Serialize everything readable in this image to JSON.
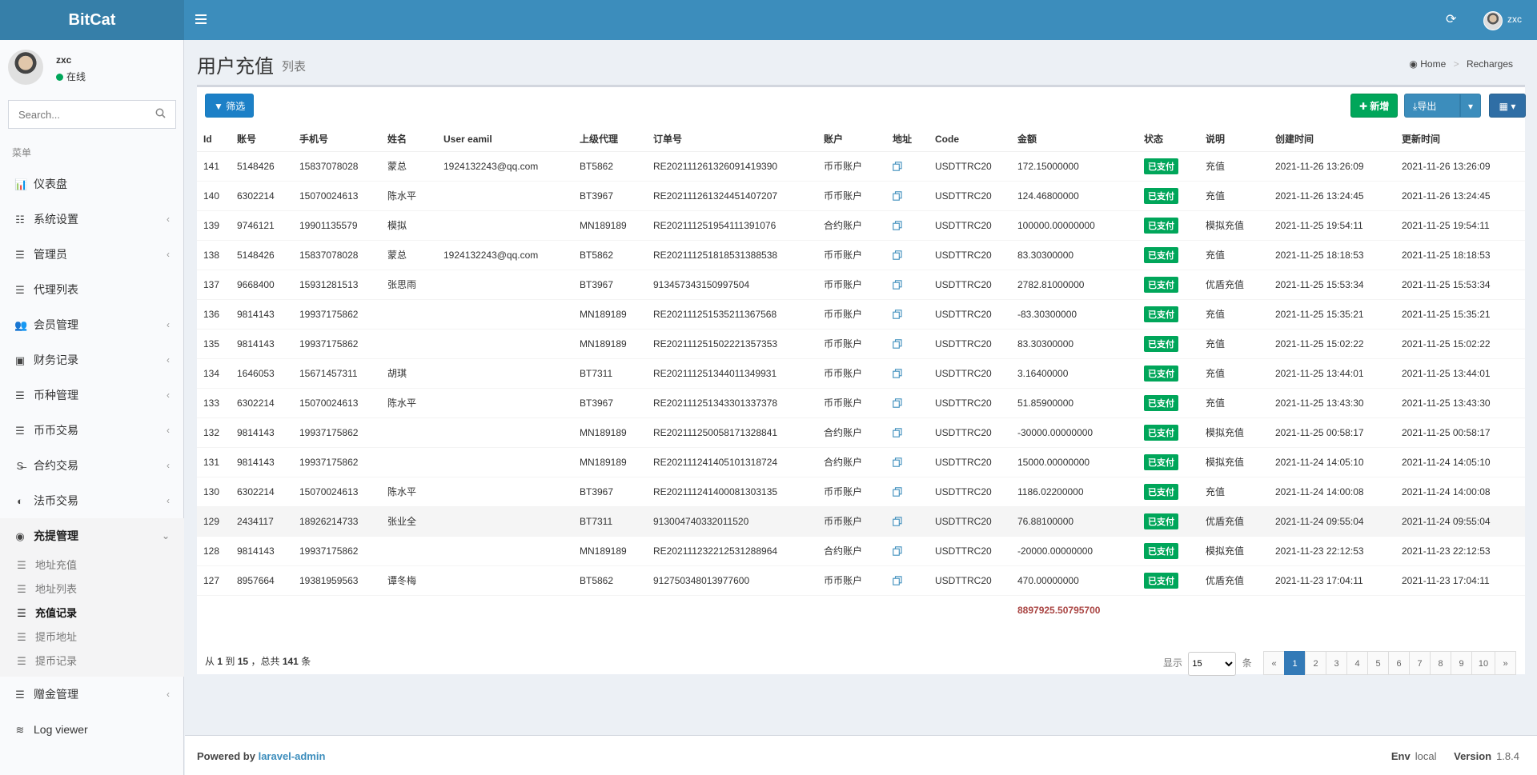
{
  "header": {
    "logo": "BitCat",
    "user": "zxc",
    "refresh_icon": "refresh-icon",
    "menu_icon": "hamburger-icon"
  },
  "sidebar": {
    "user_name": "zxc",
    "status": "在线",
    "search_placeholder": "Search...",
    "menu_header": "菜单",
    "items": [
      {
        "label": "仪表盘",
        "icon": "bar-chart-icon"
      },
      {
        "label": "系统设置",
        "icon": "sliders-icon"
      },
      {
        "label": "管理员",
        "icon": "server-icon"
      },
      {
        "label": "代理列表",
        "icon": "list-icon"
      },
      {
        "label": "会员管理",
        "icon": "users-icon"
      },
      {
        "label": "财务记录",
        "icon": "money-icon"
      },
      {
        "label": "币种管理",
        "icon": "list-icon"
      },
      {
        "label": "币币交易",
        "icon": "list-icon"
      },
      {
        "label": "合约交易",
        "icon": "strikethrough-icon"
      },
      {
        "label": "法币交易",
        "icon": "adjust-icon"
      },
      {
        "label": "充提管理",
        "icon": "dashboard-icon"
      },
      {
        "label": "赠金管理",
        "icon": "list-icon"
      },
      {
        "label": "Log viewer",
        "icon": "database-icon"
      }
    ],
    "sub_items": [
      {
        "label": "地址充值"
      },
      {
        "label": "地址列表"
      },
      {
        "label": "充值记录"
      },
      {
        "label": "提币地址"
      },
      {
        "label": "提币记录"
      }
    ]
  },
  "content": {
    "title": "用户充值",
    "subtitle": "列表",
    "breadcrumb": [
      "Home",
      "Recharges"
    ],
    "buttons": {
      "filter": "筛选",
      "add": "新增",
      "export": "导出"
    },
    "table": {
      "headers": [
        "Id",
        "账号",
        "手机号",
        "姓名",
        "User eamil",
        "上级代理",
        "订单号",
        "账户",
        "地址",
        "Code",
        "金额",
        "状态",
        "说明",
        "创建时间",
        "更新时间"
      ],
      "rows": [
        [
          "141",
          "5148426",
          "15837078028",
          "蒙总",
          "1924132243@qq.com",
          "BT5862",
          "RE20211126132609141939​0",
          "币币账户",
          "",
          "USDTTRC20",
          "172.15000000",
          "已支付",
          "充值",
          "2021-11-26 13:26:09",
          "2021-11-26 13:26:09"
        ],
        [
          "140",
          "6302214",
          "15070024613",
          "陈水平",
          "",
          "BT3967",
          "RE202111261324451407207",
          "币币账户",
          "",
          "USDTTRC20",
          "124.46800000",
          "已支付",
          "充值",
          "2021-11-26 13:24:45",
          "2021-11-26 13:24:45"
        ],
        [
          "139",
          "9746121",
          "19901135579",
          "模拟",
          "",
          "MN189189",
          "RE202111251954111391076",
          "合约账户",
          "",
          "USDTTRC20",
          "100000.00000000",
          "已支付",
          "模拟充值",
          "2021-11-25 19:54:11",
          "2021-11-25 19:54:11"
        ],
        [
          "138",
          "5148426",
          "15837078028",
          "蒙总",
          "1924132243@qq.com",
          "BT5862",
          "RE202111251818531388538",
          "币币账户",
          "",
          "USDTTRC20",
          "83.30300000",
          "已支付",
          "充值",
          "2021-11-25 18:18:53",
          "2021-11-25 18:18:53"
        ],
        [
          "137",
          "9668400",
          "15931281513",
          "张思雨",
          "",
          "BT3967",
          "913457343150997504",
          "币币账户",
          "",
          "USDTTRC20",
          "2782.81000000",
          "已支付",
          "优盾充值",
          "2021-11-25 15:53:34",
          "2021-11-25 15:53:34"
        ],
        [
          "136",
          "9814143",
          "19937175862",
          "",
          "",
          "MN189189",
          "RE202111251535211367568",
          "币币账户",
          "",
          "USDTTRC20",
          "-83.30300000",
          "已支付",
          "充值",
          "2021-11-25 15:35:21",
          "2021-11-25 15:35:21"
        ],
        [
          "135",
          "9814143",
          "19937175862",
          "",
          "",
          "MN189189",
          "RE202111251502221357353",
          "币币账户",
          "",
          "USDTTRC20",
          "83.30300000",
          "已支付",
          "充值",
          "2021-11-25 15:02:22",
          "2021-11-25 15:02:22"
        ],
        [
          "134",
          "1646053",
          "15671457311",
          "胡琪",
          "",
          "BT7311",
          "RE202111251344011349931",
          "币币账户",
          "",
          "USDTTRC20",
          "3.16400000",
          "已支付",
          "充值",
          "2021-11-25 13:44:01",
          "2021-11-25 13:44:01"
        ],
        [
          "133",
          "6302214",
          "15070024613",
          "陈水平",
          "",
          "BT3967",
          "RE202111251343301337378",
          "币币账户",
          "",
          "USDTTRC20",
          "51.85900000",
          "已支付",
          "充值",
          "2021-11-25 13:43:30",
          "2021-11-25 13:43:30"
        ],
        [
          "132",
          "9814143",
          "19937175862",
          "",
          "",
          "MN189189",
          "RE202111250058171328841",
          "合约账户",
          "",
          "USDTTRC20",
          "-30000.00000000",
          "已支付",
          "模拟充值",
          "2021-11-25 00:58:17",
          "2021-11-25 00:58:17"
        ],
        [
          "131",
          "9814143",
          "19937175862",
          "",
          "",
          "MN189189",
          "RE202111241405101318724",
          "合约账户",
          "",
          "USDTTRC20",
          "15000.00000000",
          "已支付",
          "模拟充值",
          "2021-11-24 14:05:10",
          "2021-11-24 14:05:10"
        ],
        [
          "130",
          "6302214",
          "15070024613",
          "陈水平",
          "",
          "BT3967",
          "RE202111241400081303135",
          "币币账户",
          "",
          "USDTTRC20",
          "1186.02200000",
          "已支付",
          "充值",
          "2021-11-24 14:00:08",
          "2021-11-24 14:00:08"
        ],
        [
          "129",
          "2434117",
          "18926214733",
          "张业全",
          "",
          "BT7311",
          "913004740332011520",
          "币币账户",
          "",
          "USDTTRC20",
          "76.88100000",
          "已支付",
          "优盾充值",
          "2021-11-24 09:55:04",
          "2021-11-24 09:55:04"
        ],
        [
          "128",
          "9814143",
          "19937175862",
          "",
          "",
          "MN189189",
          "RE202111232212531288964",
          "合约账户",
          "",
          "USDTTRC20",
          "-20000.00000000",
          "已支付",
          "模拟充值",
          "2021-11-23 22:12:53",
          "2021-11-23 22:12:53"
        ],
        [
          "127",
          "8957664",
          "19381959563",
          "谭冬梅",
          "",
          "BT5862",
          "912750348013977600",
          "币币账户",
          "",
          "USDTTRC20",
          "470.00000000",
          "已支付",
          "优盾充值",
          "2021-11-23 17:04:11",
          "2021-11-23 17:04:11"
        ]
      ],
      "total": "8897925.50795700"
    },
    "pagination": {
      "from": "1",
      "to": "15",
      "total": "141",
      "text_from": "从",
      "text_to": "到",
      "text_total": "，总共",
      "text_unit": "条",
      "show_label": "显示",
      "per_page": "15",
      "per_page_unit": "条",
      "prev": "«",
      "next": "»",
      "pages": [
        "1",
        "2",
        "3",
        "4",
        "5",
        "6",
        "7",
        "8",
        "9",
        "10"
      ],
      "current": "1"
    }
  },
  "footer": {
    "powered_by": "Powered by",
    "link": "laravel-admin",
    "env_label": "Env",
    "env": "local",
    "version_label": "Version",
    "version": "1.8.4"
  },
  "colors": {
    "header": "#3c8dbc",
    "success": "#00a65a",
    "total": "#a94442"
  }
}
